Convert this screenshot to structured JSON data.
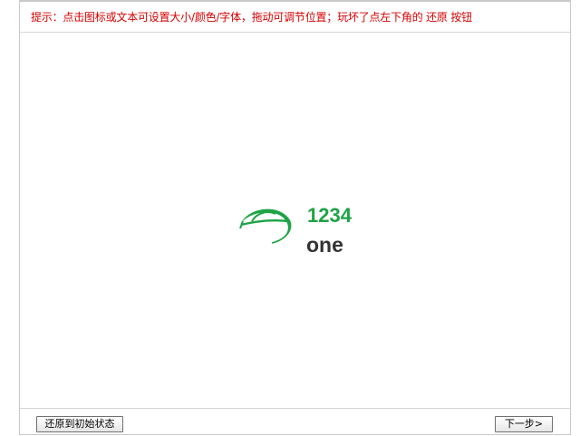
{
  "hint": {
    "text": "提示：点击图标或文本可设置大小/颜色/字体，拖动可调节位置；玩坏了点左下角的 还原 按钮"
  },
  "logo": {
    "number": "1234",
    "word": "one",
    "brand_color": "#1ea345",
    "word_color": "#333333"
  },
  "footer": {
    "reset_label": "还原到初始状态",
    "next_label": "下一步>"
  },
  "colors": {
    "hint": "#d40000",
    "border": "#c9c9c9"
  }
}
